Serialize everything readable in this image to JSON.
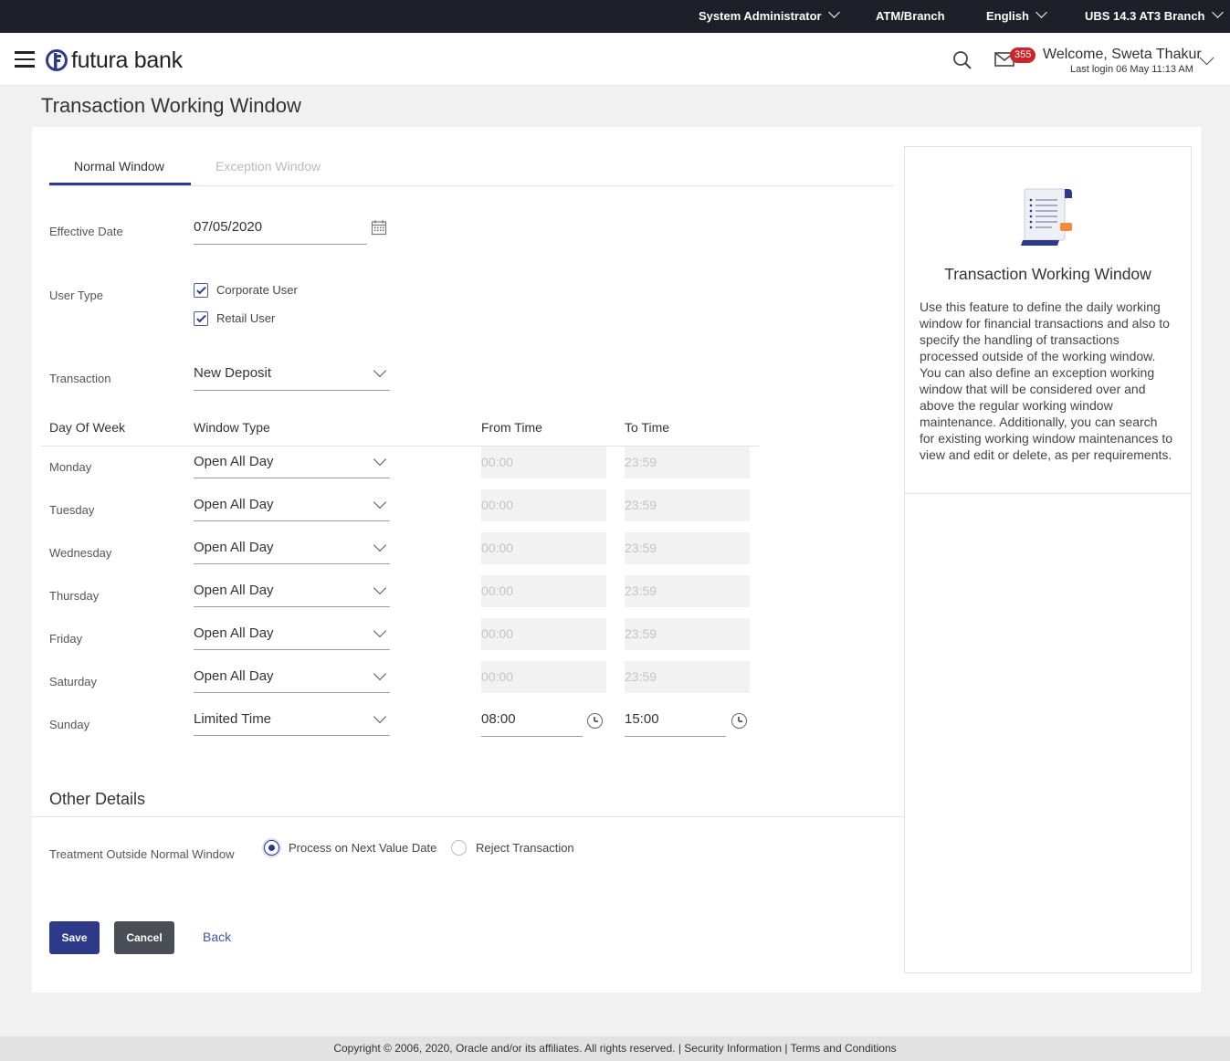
{
  "topbar": {
    "role": "System Administrator",
    "branch": "ATM/Branch",
    "language": "English",
    "entity": "UBS 14.3 AT3 Branch"
  },
  "header": {
    "logo_text": "futura bank",
    "notification_count": "355",
    "welcome": "Welcome, Sweta Thakur",
    "last_login": "Last login 06 May 11:13 AM",
    "brand_color": "#2d3a8a"
  },
  "page": {
    "title": "Transaction Working Window"
  },
  "tabs": [
    {
      "label": "Normal Window",
      "active": true
    },
    {
      "label": "Exception Window",
      "active": false
    }
  ],
  "form": {
    "effective_date_label": "Effective Date",
    "effective_date": "07/05/2020",
    "user_type_label": "User Type",
    "user_types": [
      {
        "label": "Corporate User",
        "checked": true
      },
      {
        "label": "Retail User",
        "checked": true
      }
    ],
    "transaction_label": "Transaction",
    "transaction": "New Deposit"
  },
  "schedule": {
    "headers": {
      "day": "Day Of Week",
      "window_type": "Window Type",
      "from": "From Time",
      "to": "To Time"
    },
    "rows": [
      {
        "day": "Monday",
        "window_type": "Open All Day",
        "from": "00:00",
        "to": "23:59",
        "editable": false
      },
      {
        "day": "Tuesday",
        "window_type": "Open All Day",
        "from": "00:00",
        "to": "23:59",
        "editable": false
      },
      {
        "day": "Wednesday",
        "window_type": "Open All Day",
        "from": "00:00",
        "to": "23:59",
        "editable": false
      },
      {
        "day": "Thursday",
        "window_type": "Open All Day",
        "from": "00:00",
        "to": "23:59",
        "editable": false
      },
      {
        "day": "Friday",
        "window_type": "Open All Day",
        "from": "00:00",
        "to": "23:59",
        "editable": false
      },
      {
        "day": "Saturday",
        "window_type": "Open All Day",
        "from": "00:00",
        "to": "23:59",
        "editable": false
      },
      {
        "day": "Sunday",
        "window_type": "Limited Time",
        "from": "08:00",
        "to": "15:00",
        "editable": true
      }
    ]
  },
  "other_details": {
    "title": "Other Details",
    "treatment_label": "Treatment Outside Normal Window",
    "options": [
      {
        "label": "Process on Next Value Date",
        "selected": true
      },
      {
        "label": "Reject Transaction",
        "selected": false
      }
    ]
  },
  "actions": {
    "save": "Save",
    "cancel": "Cancel",
    "back": "Back"
  },
  "help": {
    "title": "Transaction Working Window",
    "text": "Use this feature to define the daily working window for financial transactions and also to specify the handling of transactions processed outside of the working window. You can also define an exception working window that will be considered over and above the regular working window maintenance. Additionally, you can search for existing working window maintenances to view and edit or delete, as per requirements."
  },
  "footer": {
    "copyright": "Copyright © 2006, 2020, Oracle and/or its affiliates. All rights reserved.",
    "security": "Security Information",
    "terms": "Terms and Conditions"
  }
}
